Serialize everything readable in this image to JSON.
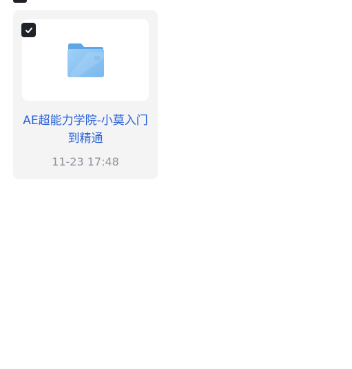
{
  "file_card": {
    "name": "AE超能力学院-小莫入门到精通",
    "modified_time": "11-23 17:48",
    "selected": true,
    "icon": "folder-icon"
  },
  "colors": {
    "card_bg": "#f4f4f5",
    "name_text": "#2a62d8",
    "time_text": "#8f959e",
    "checkbox_bg": "#1f2329",
    "folder_blue": "#7ab8ef"
  }
}
